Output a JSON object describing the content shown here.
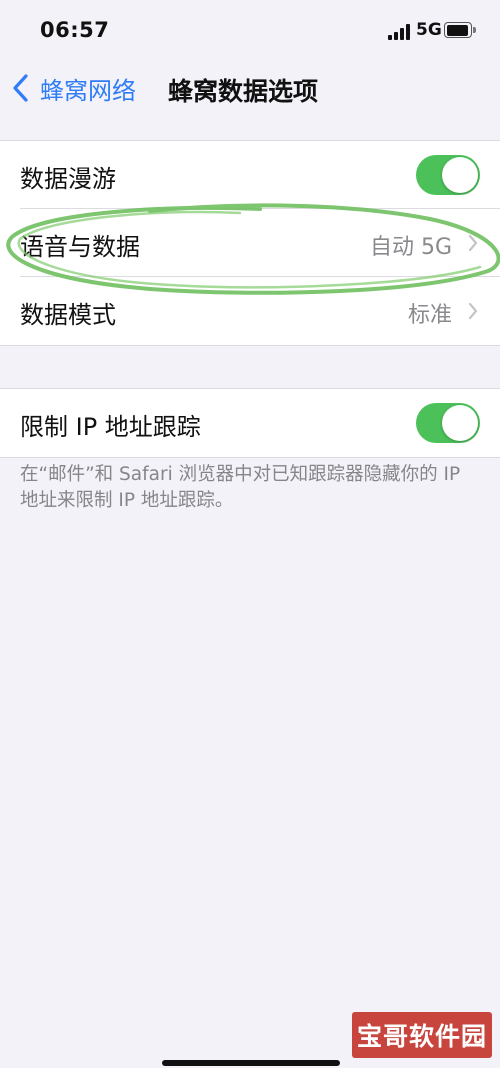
{
  "status_bar": {
    "time": "06:57",
    "network": "5G"
  },
  "nav": {
    "back_label": "蜂窝网络",
    "title": "蜂窝数据选项"
  },
  "section1": {
    "rows": [
      {
        "label": "数据漫游",
        "toggle_on": true
      },
      {
        "label": "语音与数据",
        "value": "自动 5G"
      },
      {
        "label": "数据模式",
        "value": "标准"
      }
    ]
  },
  "section2": {
    "rows": [
      {
        "label": "限制 IP 地址跟踪",
        "toggle_on": true
      }
    ],
    "footer": "在“邮件”和 Safari 浏览器中对已知跟踪器隐藏你的 IP 地址来限制 IP 地址跟踪。"
  },
  "watermark": "宝哥软件园",
  "colors": {
    "accent": "#2f7cf6",
    "toggle_on": "#4cc15a",
    "annotation": "#6fbf5e",
    "watermark": "#c8453e"
  }
}
